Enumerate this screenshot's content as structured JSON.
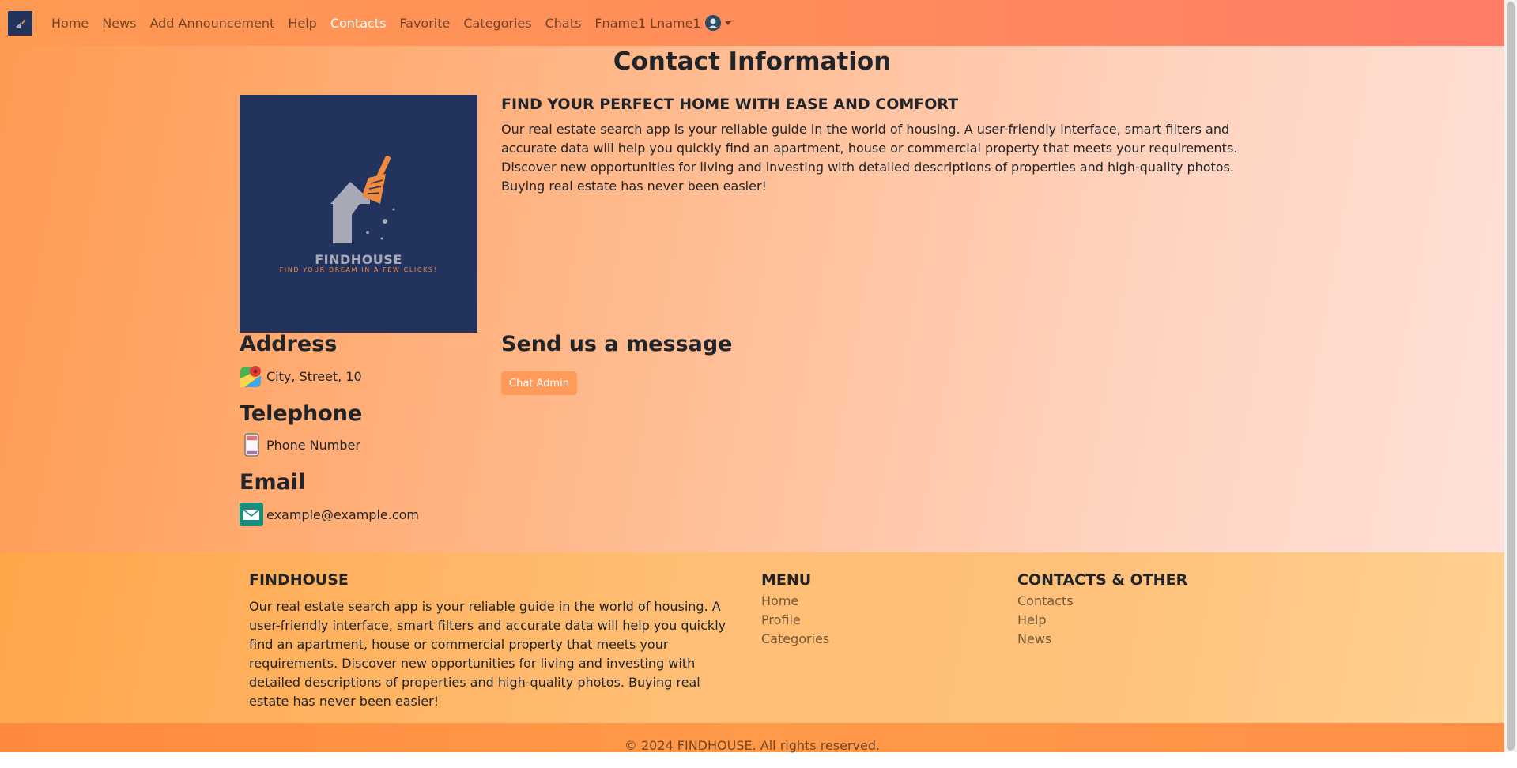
{
  "navbar": {
    "links": [
      "Home",
      "News",
      "Add Announcement",
      "Help",
      "Contacts",
      "Favorite",
      "Categories",
      "Chats"
    ],
    "active_index": 4,
    "user_name": "Fname1 Lname1"
  },
  "main": {
    "title": "Contact Information",
    "logo": {
      "name": "FINDHOUSE",
      "tagline": "FIND YOUR DREAM IN A FEW CLICKS!"
    },
    "about_heading": "FIND YOUR PERFECT HOME WITH EASE AND COMFORT",
    "about_text": "Our real estate search app is your reliable guide in the world of housing. A user-friendly interface, smart filters and accurate data will help you quickly find an apartment, house or commercial property that meets your requirements. Discover new opportunities for living and investing with detailed descriptions of properties and high-quality photos. Buying real estate has never been easier!",
    "address_heading": "Address",
    "address_value": "City, Street, 10",
    "telephone_heading": "Telephone",
    "telephone_value": "Phone Number",
    "email_heading": "Email",
    "email_value": "example@example.com",
    "message_heading": "Send us a message",
    "chat_button": "Chat Admin"
  },
  "footer": {
    "brand_heading": "FINDHOUSE",
    "brand_text": "Our real estate search app is your reliable guide in the world of housing. A user-friendly interface, smart filters and accurate data will help you quickly find an apartment, house or commercial property that meets your requirements. Discover new opportunities for living and investing with detailed descriptions of properties and high-quality photos. Buying real estate has never been easier!",
    "menu_heading": "MENU",
    "menu_links": [
      "Home",
      "Profile",
      "Categories"
    ],
    "contacts_heading": "CONTACTS & OTHER",
    "contacts_links": [
      "Contacts",
      "Help",
      "News"
    ],
    "copyright": "© 2024 FINDHOUSE. All rights reserved."
  },
  "colors": {
    "brand_navy": "#22345e",
    "accent_orange": "#ff9a5a"
  },
  "icons": {
    "brand": "broom-house-icon",
    "address": "map-pin-icon",
    "telephone": "mobile-phone-icon",
    "email": "envelope-icon",
    "avatar": "user-avatar-icon"
  }
}
